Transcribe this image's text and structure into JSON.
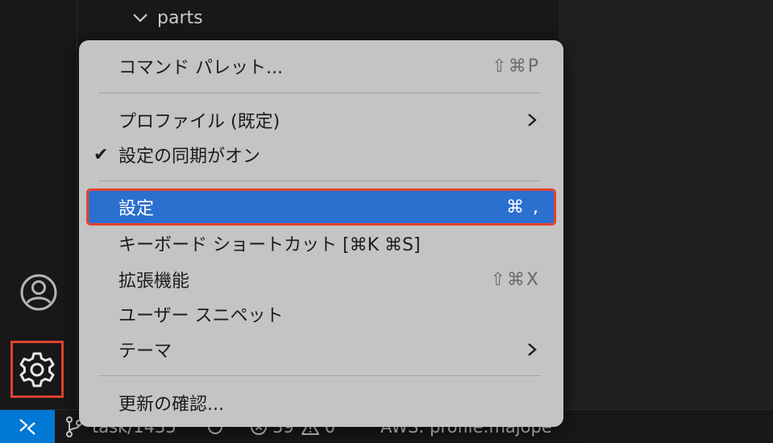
{
  "explorer": {
    "tree_item_label": "parts"
  },
  "activity_bar": {
    "account_icon": "account-icon",
    "manage_icon": "gear-icon"
  },
  "context_menu": {
    "command_palette": {
      "label": "コマンド パレット...",
      "shortcut": "⇧⌘P"
    },
    "profile": {
      "label": "プロファイル (既定)"
    },
    "settings_sync": {
      "label": "設定の同期がオン",
      "checked": "✔"
    },
    "settings": {
      "label": "設定",
      "shortcut": "⌘ ,"
    },
    "keyboard_shortcuts": {
      "label": "キーボード ショートカット [⌘K ⌘S]"
    },
    "extensions": {
      "label": "拡張機能",
      "shortcut": "⇧⌘X"
    },
    "user_snippets": {
      "label": "ユーザー スニペット"
    },
    "theme": {
      "label": "テーマ"
    },
    "check_updates": {
      "label": "更新の確認..."
    }
  },
  "status_bar": {
    "branch": "task/1435",
    "errors": "39",
    "warnings": "0",
    "aws_profile": "AWS: profile:majope"
  },
  "colors": {
    "accent": "#0078d4",
    "highlight": "#2b6fcf",
    "annotation": "#e0442f"
  }
}
